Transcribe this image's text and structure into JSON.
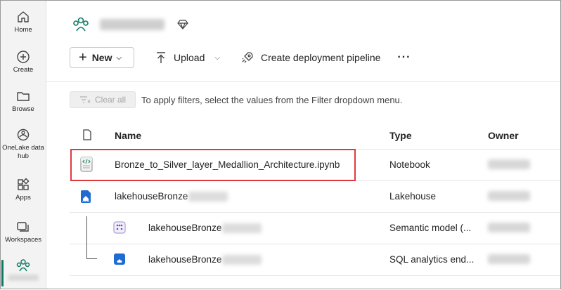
{
  "nav": {
    "items": [
      {
        "label": "Home",
        "icon": "home-icon"
      },
      {
        "label": "Create",
        "icon": "create-icon"
      },
      {
        "label": "Browse",
        "icon": "folder-icon"
      },
      {
        "label": "OneLake data hub",
        "icon": "onelake-icon"
      },
      {
        "label": "Apps",
        "icon": "apps-icon"
      },
      {
        "label": "Workspaces",
        "icon": "workspaces-icon"
      }
    ]
  },
  "toolbar": {
    "new_label": "New",
    "upload_label": "Upload",
    "pipeline_label": "Create deployment pipeline",
    "more_label": "···"
  },
  "filter": {
    "clear_label": "Clear all",
    "hint": "To apply filters, select the values from the Filter dropdown menu."
  },
  "table": {
    "columns": {
      "name": "Name",
      "type": "Type",
      "owner": "Owner"
    },
    "rows": [
      {
        "name": "Bronze_to_Silver_layer_Medallion_Architecture.ipynb",
        "type": "Notebook",
        "icon": "notebook-icon"
      },
      {
        "name": "lakehouseBronze",
        "type": "Lakehouse",
        "icon": "lakehouse-icon"
      },
      {
        "name": "lakehouseBronze",
        "type": "Semantic model (...",
        "icon": "semantic-model-icon"
      },
      {
        "name": "lakehouseBronze",
        "type": "SQL analytics end...",
        "icon": "sql-endpoint-icon"
      }
    ]
  },
  "colors": {
    "accent": "#117865",
    "highlight": "#e03a3e"
  }
}
